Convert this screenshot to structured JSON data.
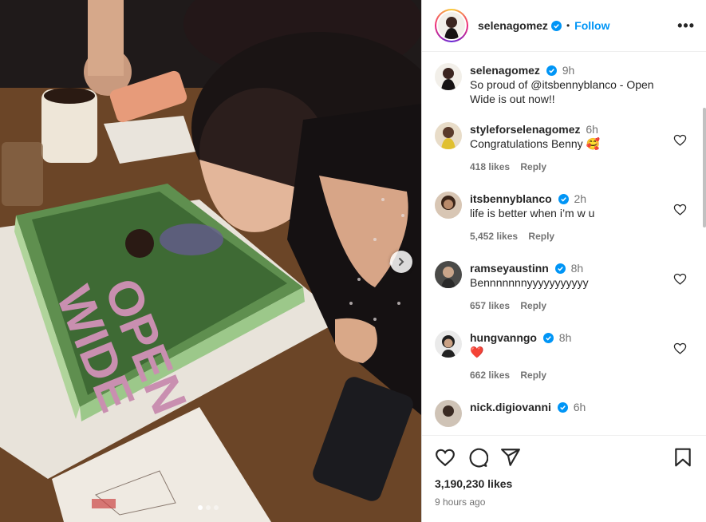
{
  "post": {
    "author": "selenagomez",
    "follow_label": "Follow",
    "separator": "•",
    "more_label": "•••"
  },
  "caption": {
    "user": "selenagomez",
    "time": "9h",
    "text": "So proud of @itsbennyblanco - Open Wide is out now!!"
  },
  "comments": [
    {
      "user": "styleforselenagomez",
      "time": "6h",
      "text": "Congratulations Benny 🥰",
      "likes": "418 likes",
      "reply": "Reply",
      "verified": false
    },
    {
      "user": "itsbennyblanco",
      "time": "2h",
      "text": "life is better when i’m w u",
      "likes": "5,452 likes",
      "reply": "Reply",
      "verified": true
    },
    {
      "user": "ramseyaustinn",
      "time": "8h",
      "text": "Bennnnnnnyyyyyyyyyyy",
      "likes": "657 likes",
      "reply": "Reply",
      "verified": true
    },
    {
      "user": "hungvanngo",
      "time": "8h",
      "text": "❤️",
      "likes": "662 likes",
      "reply": "Reply",
      "verified": true
    },
    {
      "user": "nick.digiovanni",
      "time": "6h",
      "text": "",
      "likes": "",
      "reply": "",
      "verified": true
    }
  ],
  "footer": {
    "likes": "3,190,230 likes",
    "posted": "9 hours ago"
  },
  "icons": [
    "heart-icon",
    "comment-icon",
    "share-icon",
    "save-icon",
    "verified-icon",
    "chevron-right-icon",
    "more-icon"
  ],
  "colors": {
    "accent": "#0095f6",
    "verified": "#0095f6",
    "heart": "#ed4956"
  },
  "carousel": {
    "count": 3,
    "active": 1
  }
}
